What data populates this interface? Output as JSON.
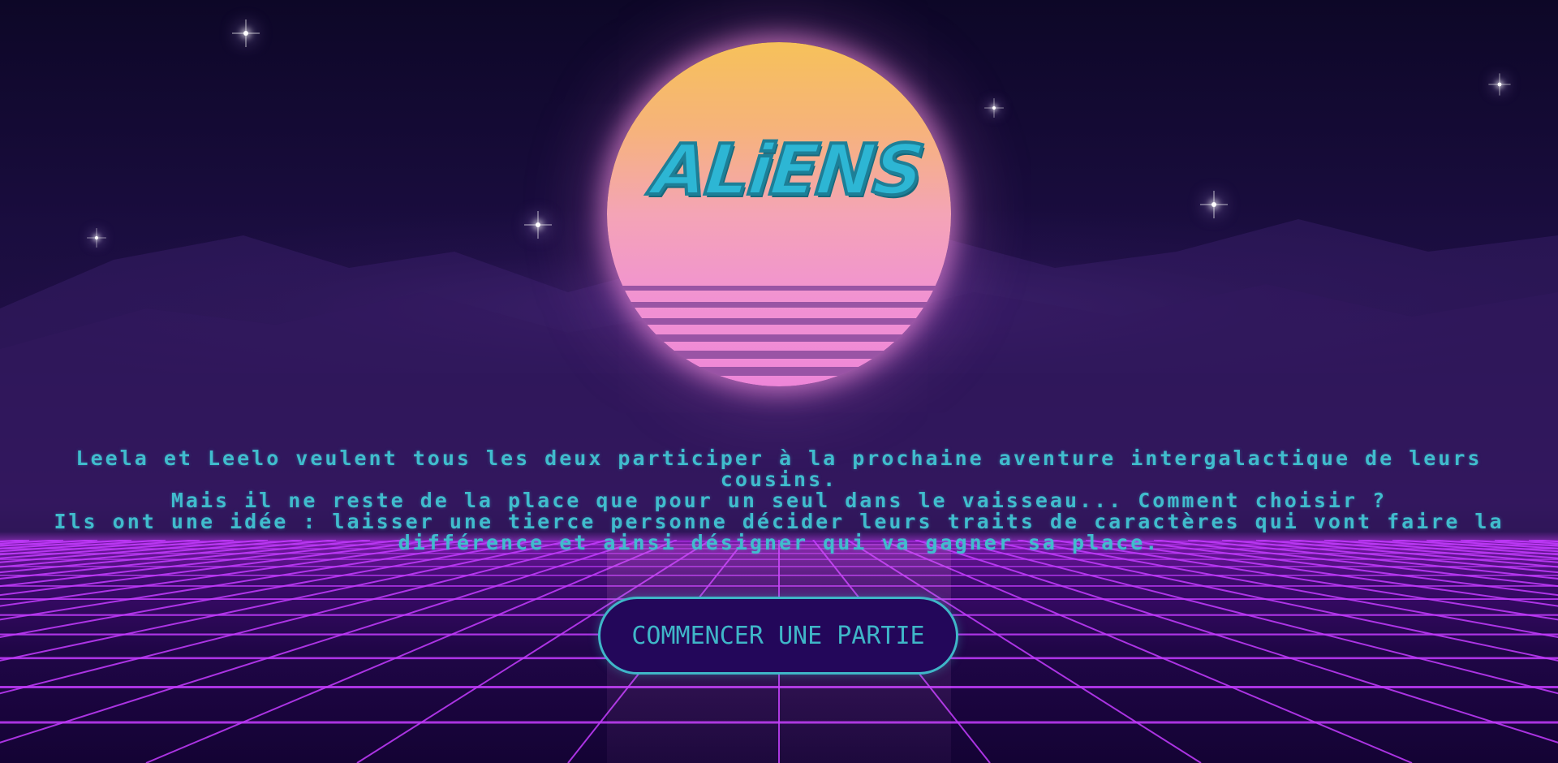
{
  "game": {
    "logo_text": "ALiENS",
    "intro_lines": [
      "Leela et Leelo veulent tous les deux participer à la prochaine aventure intergalactique de leurs cousins.",
      "Mais il ne reste de la place que pour un seul dans le vaisseau... Comment choisir ?",
      "Ils ont une idée : laisser une tierce personne décider leurs traits de caractères qui vont faire la différence et ainsi désigner qui va gagner sa place."
    ],
    "start_button_label": "COMMENCER UNE PARTIE"
  },
  "theme": {
    "text_color": "#40bccd",
    "button_bg": "#23075a",
    "grid_color": "#c43cff",
    "sun_top": "#f6c15a",
    "sun_bottom": "#ee86d8"
  },
  "icons": [
    "star-icon",
    "sun-icon"
  ]
}
